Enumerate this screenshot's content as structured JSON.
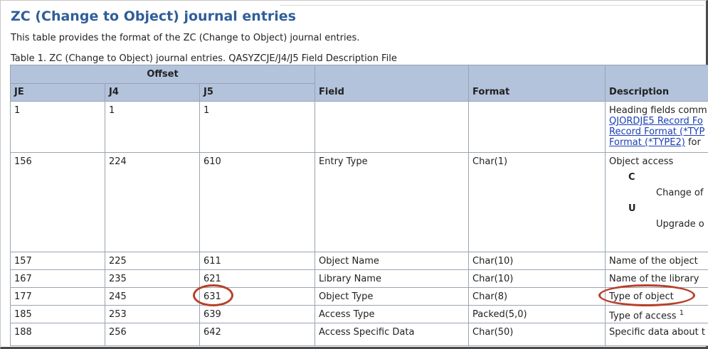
{
  "page": {
    "title": "ZC (Change to Object) journal entries",
    "intro": "This table provides the format of the ZC (Change to Object) journal entries.",
    "caption": "Table 1. ZC (Change to Object) journal entries. QASYZCJE/J4/J5 Field Description File"
  },
  "table": {
    "headers": {
      "offset": "Offset",
      "je": "JE",
      "j4": "J4",
      "j5": "J5",
      "field": "Field",
      "format": "Format",
      "description": "Description"
    },
    "row1": {
      "je": "1",
      "j4": "1",
      "j5": "1",
      "field": "",
      "format": "",
      "desc_text": "Heading fields comm",
      "link1": "QJORDJE5 Record Fo",
      "link2": "Record Format (*TYP",
      "link3": "Format (*TYPE2)",
      "desc_tail": " for"
    },
    "row2": {
      "je": "156",
      "j4": "224",
      "j5": "610",
      "field": "Entry Type",
      "format": "Char(1)",
      "desc_text": "Object access",
      "code_c": "C",
      "meaning_c": "Change of",
      "code_u": "U",
      "meaning_u": "Upgrade o"
    },
    "row3": {
      "je": "157",
      "j4": "225",
      "j5": "611",
      "field": "Object Name",
      "format": "Char(10)",
      "desc": "Name of the object"
    },
    "row4": {
      "je": "167",
      "j4": "235",
      "j5": "621",
      "field": "Library Name",
      "format": "Char(10)",
      "desc": "Name of the library"
    },
    "row5": {
      "je": "177",
      "j4": "245",
      "j5": "631",
      "field": "Object Type",
      "format": "Char(8)",
      "desc": "Type of object"
    },
    "row6": {
      "je": "185",
      "j4": "253",
      "j5": "639",
      "field": "Access Type",
      "format": "Packed(5,0)",
      "desc": "Type of access",
      "note": "1"
    },
    "row7": {
      "je": "188",
      "j4": "256",
      "j5": "642",
      "field": "Access Specific Data",
      "format": "Char(50)",
      "desc": "Specific data about t"
    }
  },
  "colors": {
    "title": "#2f5e9a",
    "header_bg": "#b3c3dc",
    "link": "#1a3fb5",
    "highlight_circle": "#b8402a"
  }
}
